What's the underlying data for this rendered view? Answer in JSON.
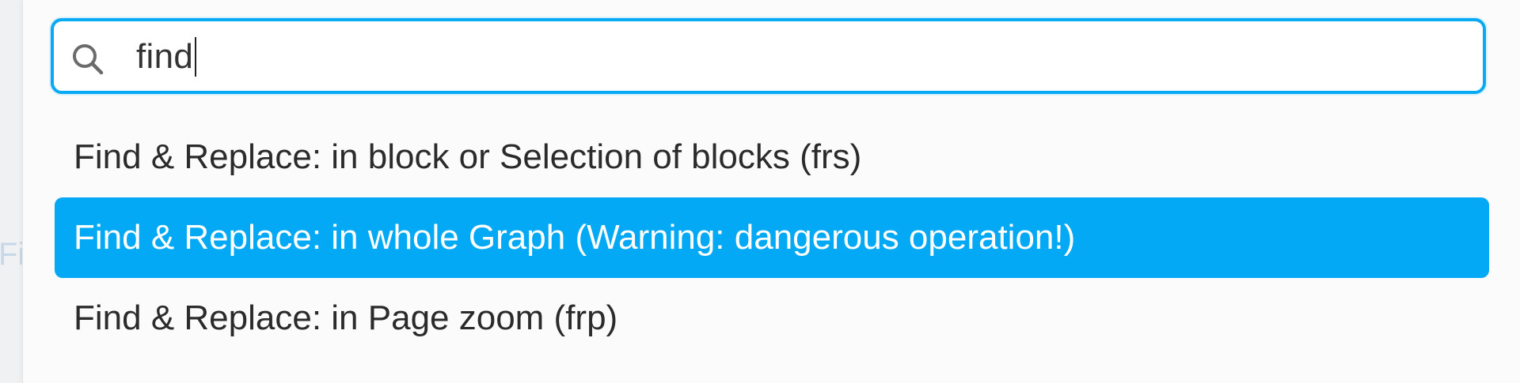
{
  "background": {
    "fragment_text": "Fi"
  },
  "search": {
    "icon": "search-icon",
    "value": "find"
  },
  "results": [
    {
      "label": "Find & Replace: in block or Selection of blocks (frs)",
      "selected": false
    },
    {
      "label": "Find & Replace: in whole Graph (Warning: dangerous operation!)",
      "selected": true
    },
    {
      "label": "Find & Replace: in Page zoom (frp)",
      "selected": false
    }
  ],
  "colors": {
    "accent": "#03a9f4",
    "border": "#08a9f5",
    "text": "#2b2b2b",
    "selected_text": "#ffffff",
    "panel": "#fbfbfb"
  }
}
